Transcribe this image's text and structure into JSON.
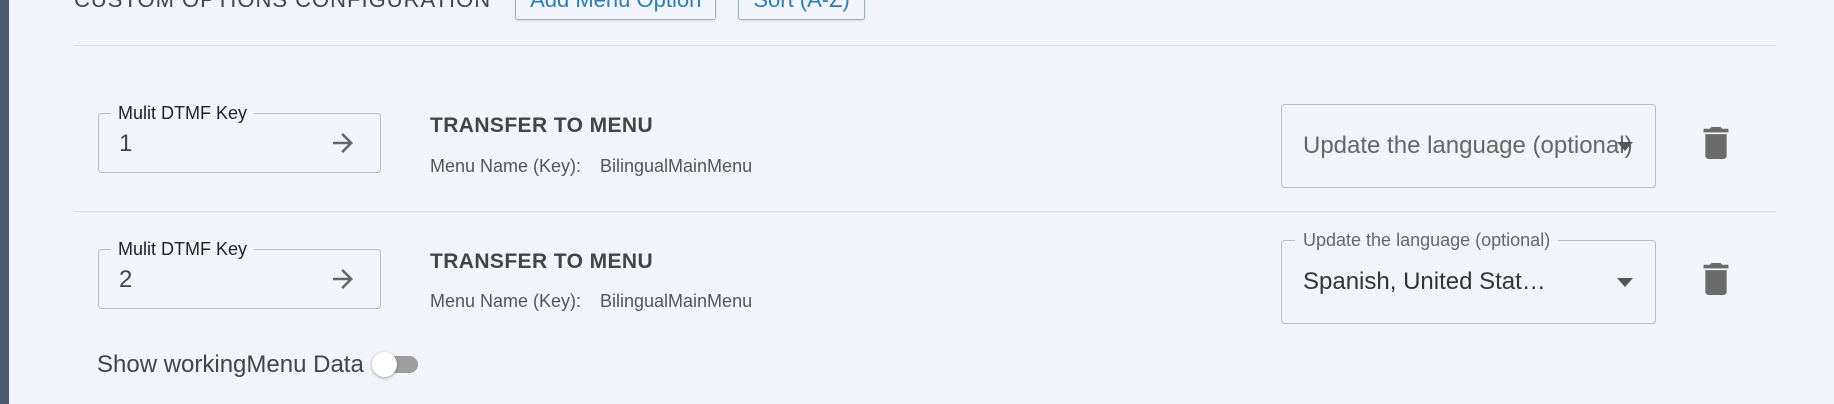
{
  "header": {
    "section_title": "CUSTOM OPTIONS CONFIGURATION",
    "add_button_label": "Add Menu Option",
    "sort_button_label": "Sort (A-Z)"
  },
  "options": [
    {
      "key_label": "Mulit DTMF Key",
      "key_value": "1",
      "action_title": "TRANSFER TO MENU",
      "menu_name_label": "Menu Name (Key):",
      "menu_name_value": "BilingualMainMenu",
      "language_placeholder": "Update the language (optional)",
      "language_label": "",
      "language_value": ""
    },
    {
      "key_label": "Mulit DTMF Key",
      "key_value": "2",
      "action_title": "TRANSFER TO MENU",
      "menu_name_label": "Menu Name (Key):",
      "menu_name_value": "BilingualMainMenu",
      "language_placeholder": "",
      "language_label": "Update the language (optional)",
      "language_value": "Spanish, United Stat…"
    }
  ],
  "footer": {
    "toggle_label": "Show workingMenu Data",
    "toggle_on": false
  },
  "colors": {
    "background": "#f1f5fb",
    "accent": "#2b7fb0",
    "border": "#bcbcbc",
    "toggle_track": "#9e9e9e"
  },
  "icons": [
    "arrow-right-icon",
    "trash-icon",
    "chevron-down-icon"
  ]
}
